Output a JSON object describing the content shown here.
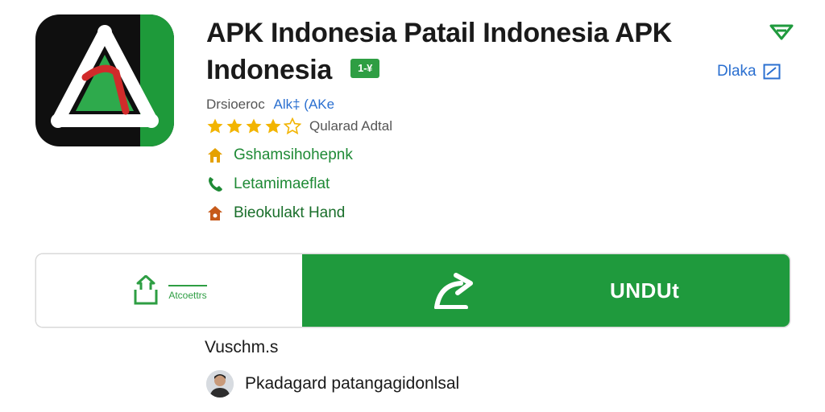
{
  "header": {
    "title": "APK Indonesia Patail Indonesia APK Indonesia",
    "badge": "1-¥",
    "download_link": "Dlaka"
  },
  "meta": {
    "developer_label": "Drsioeroc",
    "developer_name": "Alk‡ (AKe",
    "rating_value": 4,
    "rating_max": 5,
    "rating_text": "Qularad Adtal"
  },
  "info_rows": [
    {
      "text": "Gshamsihohepnk",
      "icon": "home-icon",
      "color": "#e5a100"
    },
    {
      "text": "Letamimaeflat",
      "icon": "phone-icon",
      "color": "#1f8a36"
    },
    {
      "text": "Bieokulakt Hand",
      "icon": "house-icon",
      "color": "#c65a1a"
    }
  ],
  "actions": {
    "share_label": "Atcoettrs",
    "download_label": "UNDUt"
  },
  "section": {
    "title": "Vuschm.s",
    "author_name": "Pkadagard patangagidonlsal"
  },
  "colors": {
    "primary_green": "#1f9a3d",
    "link_blue": "#2a6fd0",
    "star_yellow": "#f2b400"
  }
}
